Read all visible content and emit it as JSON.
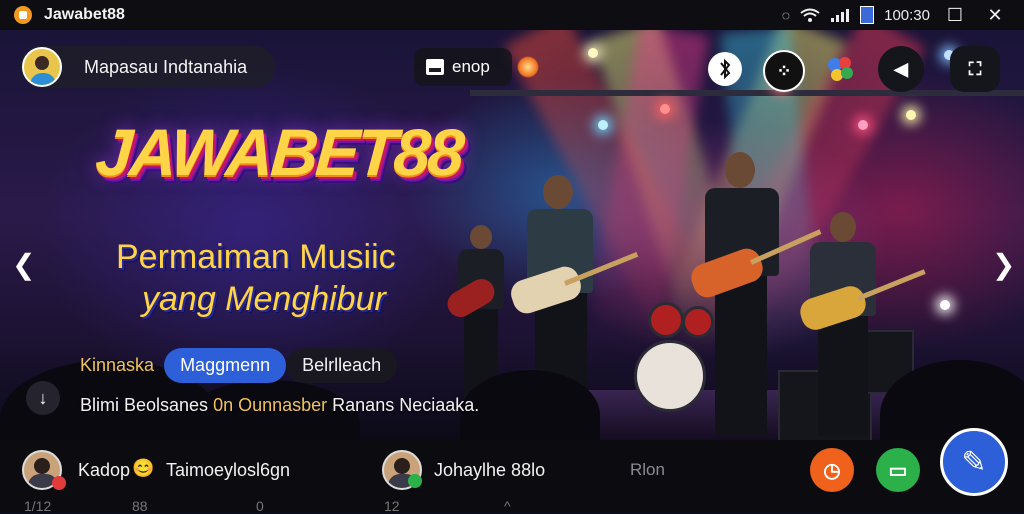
{
  "status_bar": {
    "app_title": "Jawabet88",
    "clock": "100:30",
    "icons": [
      "sync-icon",
      "wifi-icon",
      "signal-icon",
      "battery-icon"
    ],
    "window_buttons": [
      "maximize-icon",
      "close-icon"
    ]
  },
  "header": {
    "profile_name": "Mapasau Indtanahia",
    "shop_label": "enop",
    "action_icons": [
      "bluetooth-icon",
      "grid-icon",
      "maps-icon",
      "megaphone-icon",
      "fullscreen-icon"
    ]
  },
  "hero": {
    "title": "JAWABET88",
    "subtitle_line1": "Permaiman Musiic",
    "subtitle_line2": "yang Menghibur",
    "tags": {
      "plain": "Kinnaska",
      "active": "Maggmenn",
      "dark": "Belrlleach"
    },
    "caption_part1": "Blimi Beolsanes ",
    "caption_highlight": "0n Ounnasber",
    "caption_part2": " Ranans Neciaaka."
  },
  "bottom_bar": {
    "user1_name": "Kadop",
    "user1_emoji": "😊",
    "user1_caption": "Taimoeylosl6gn",
    "user2_name": "Johaylhe 88lo",
    "muted_label": "Rlon",
    "strip_labels": [
      "1/12",
      "88",
      "0",
      "12",
      "^"
    ]
  },
  "colors": {
    "accent_blue": "#2d5fd8",
    "accent_yellow": "#ffd447",
    "orange_button": "#f0621c",
    "green_button": "#2bb04a"
  }
}
